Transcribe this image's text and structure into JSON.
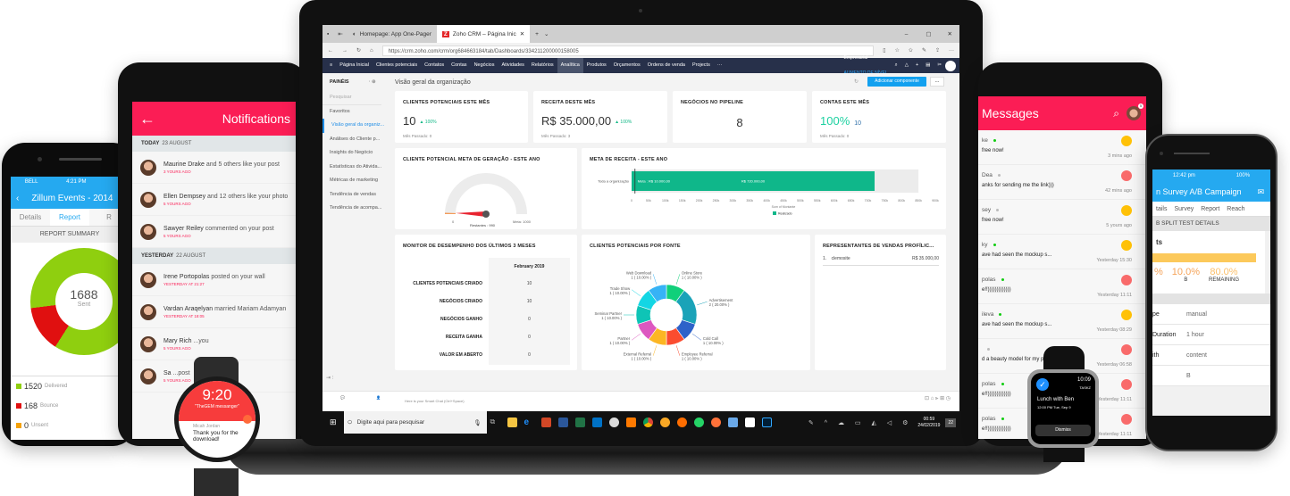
{
  "left_phone": {
    "status": {
      "carrier": "BELL",
      "time": "4:21 PM"
    },
    "title": "Zillum Events - 2014",
    "tabs": [
      "Details",
      "Report",
      "R"
    ],
    "active_tab": "Report",
    "section": "REPORT SUMMARY",
    "donut": {
      "total": "1688",
      "total_label": "Sent",
      "delivered_fraction": 0.9,
      "bounce_fraction": 0.1
    },
    "legend": [
      {
        "value": "1520",
        "label": "Delivered",
        "pct": "90",
        "color": "#8fcf0f"
      },
      {
        "value": "168",
        "label": "Bounce",
        "pct": "10",
        "color": "#e01010"
      },
      {
        "value": "0",
        "label": "Unsent",
        "pct": "",
        "color": "#f5a20a"
      }
    ]
  },
  "left_tablet": {
    "title": "Notifications",
    "groups": [
      {
        "day": "TODAY",
        "date": "23 AUGUST",
        "items": [
          {
            "name": "Maurine Drake",
            "rest": " and 5 others like your post",
            "time": "3 YOURS AGO"
          },
          {
            "name": "Ellen Dempsey",
            "rest": " and 12 others like your photo",
            "time": "5 YOURS AGO"
          },
          {
            "name": "Sawyer Reiley",
            "rest": " commented on your post",
            "time": "5 YOURS AGO"
          }
        ]
      },
      {
        "day": "YESTERDAY",
        "date": "22 AUGUST",
        "items": [
          {
            "name": "Irene Portopolas",
            "rest": " posted on your wall",
            "time": "YESTERDAY AT 21:27"
          },
          {
            "name": "Vardan Araqelyan",
            "rest": " married Mariam Adamyan",
            "time": "YESTERDAY AT 18:05"
          },
          {
            "name": "Mary Rich",
            "rest": " ...you",
            "time": "5 YOURS AGO"
          },
          {
            "name": "Sa",
            "rest": " ...post",
            "time": "5 YOURS AGO"
          }
        ]
      }
    ]
  },
  "watch_left": {
    "time": "9:20",
    "app": "\"TheGEM messanger\"",
    "sender": "Micah Jordan",
    "message": "Thank you for the download!"
  },
  "browser": {
    "tabs": [
      {
        "label": "Homepage: App One-Pager",
        "active": false
      },
      {
        "label": "Zoho CRM – Página Inic",
        "active": true
      }
    ],
    "url": "https://crm.zoho.com/crm/org684663184/tab/Dashboards/334211200000158005"
  },
  "crm": {
    "nav": [
      "Página Inicial",
      "Clientes potenciais",
      "Contatos",
      "Contas",
      "Negócios",
      "Atividades",
      "Relatórios",
      "Analítica",
      "Produtos",
      "Orçamentos",
      "Ordens de venda",
      "Projects",
      "···"
    ],
    "active_nav": "Analítica",
    "edition": "Empresarial",
    "upgrade": "AUMENTO DE NÍVEL",
    "sidebar": {
      "title": "PAINÉIS",
      "search_placeholder": "Pesquisar",
      "items": [
        "Favoritos",
        "Visão geral da organiz...",
        "Análises do Cliente p...",
        "Insights do Negócio",
        "Estatísticas do Ativida...",
        "Métricas de marketing",
        "Tendência de vendas",
        "Tendência de acompa..."
      ],
      "active": "Visão geral da organiz..."
    },
    "page_title": "Visão geral da organização",
    "add_component": "Adicionar componente",
    "more": "...",
    "kpis": [
      {
        "title": "CLIENTES POTENCIAIS ESTE MÊS",
        "value": "10",
        "change": "▲ 100%",
        "prev": "Mês Passado: 0"
      },
      {
        "title": "RECEITA DESTE MÊS",
        "value": "R$ 35.000,00",
        "change": "▲ 100%",
        "prev": "Mês Passado: 3"
      },
      {
        "title": "NEGÓCIOS NO PIPELINE",
        "value": "8",
        "change": "",
        "prev": ""
      },
      {
        "title": "CONTAS ESTE MÊS",
        "value": "100%",
        "sub": "10",
        "prev": "Mês Passado: 0"
      }
    ],
    "gauge": {
      "title": "CLIENTE POTENCIAL META DE GERAÇÃO - ESTE ANO",
      "min": "0",
      "max": "Meta: 1000",
      "remaining": "Restantes : 990",
      "value": 10,
      "target": 1000
    },
    "monitor": {
      "title": "MONITOR DE DESEMPENHO DOS ÚLTIMOS 3 MESES",
      "column": "February 2019",
      "rows": [
        {
          "label": "CLIENTES POTENCIAIS CRIADO",
          "value": "10"
        },
        {
          "label": "NEGÓCIOS CRIADO",
          "value": "10"
        },
        {
          "label": "NEGÓCIOS GANHO",
          "value": "0"
        },
        {
          "label": "RECEITA GANHA",
          "value": "0"
        },
        {
          "label": "VALOR EM ABERTO",
          "value": "0"
        }
      ]
    },
    "reps": {
      "title": "REPRESENTANTES DE VENDAS PROFÍLIC...",
      "rows": [
        {
          "rank": "1.",
          "name": "clemosite",
          "value": "R$ 35.000,00"
        }
      ]
    },
    "bottom": {
      "smart_chat": "Here is your Smart Chat (Ctrl+Space)"
    }
  },
  "chart_data": [
    {
      "type": "bar",
      "title": "META DE RECEITA - ESTE ANO",
      "categories": [
        "Toda a organização"
      ],
      "series": [
        {
          "name": "Realizado",
          "values": [
            720000
          ]
        }
      ],
      "target_label": "Meta : R$ 10.000,00",
      "value_label": "R$ 720.000,00",
      "xlabel": "Sum of Montante",
      "xticks": [
        "0",
        "50k",
        "100k",
        "150k",
        "200k",
        "250k",
        "300k",
        "350k",
        "400k",
        "450k",
        "500k",
        "550k",
        "600k",
        "650k",
        "700k",
        "750k",
        "800k",
        "850k",
        "900k"
      ],
      "xlim": [
        0,
        900000
      ],
      "background_max": 850000,
      "legend": "bottom",
      "color": "#0fb78a"
    },
    {
      "type": "pie",
      "title": "CLIENTES POTENCIAIS POR FONTE",
      "slices": [
        {
          "label": "Online Store",
          "value": 1,
          "pct": "10.00%",
          "color": "#10d07a"
        },
        {
          "label": "Advertisement",
          "value": 2,
          "pct": "20.00%",
          "color": "#1aa3b8"
        },
        {
          "label": "Cold Call",
          "value": 1,
          "pct": "10.00%",
          "color": "#2e62c9"
        },
        {
          "label": "Employee Referral",
          "value": 1,
          "pct": "10.00%",
          "color": "#fb4c2f"
        },
        {
          "label": "External Referral",
          "value": 1,
          "pct": "10.00%",
          "color": "#fcb623"
        },
        {
          "label": "Partner",
          "value": 1,
          "pct": "10.00%",
          "color": "#dd58c0"
        },
        {
          "label": "Seminar Partner",
          "value": 1,
          "pct": "10.00%",
          "color": "#0ec4b6"
        },
        {
          "label": "Trade Show",
          "value": 1,
          "pct": "10.00%",
          "color": "#13d6e4"
        },
        {
          "label": "Web Download",
          "value": 1,
          "pct": "10.00%",
          "color": "#36b3f6"
        }
      ],
      "donut": true
    }
  ],
  "taskbar": {
    "search_placeholder": "Digite aqui para pesquisar",
    "time": "00:59",
    "date": "24/02/2019",
    "notifications": "22"
  },
  "right_tablet": {
    "title": "Messages",
    "badge": "5",
    "items": [
      {
        "name": "ke",
        "online": true,
        "msg": "free now!",
        "time": "3 mins ago",
        "badge_color": "#ffc107"
      },
      {
        "name": "Dea",
        "online": false,
        "msg": "anks for sending me the link)))",
        "time": "42 mins ago",
        "badge_color": "#f96b6b"
      },
      {
        "name": "sey",
        "online": false,
        "msg": "free now!",
        "time": "5 yours ago",
        "badge_color": "#ffc107"
      },
      {
        "name": "ky",
        "online": true,
        "msg": "ave had seen the mockup s...",
        "time": "Yesterday 15:30",
        "badge_color": "#ffc107"
      },
      {
        "name": "polas",
        "online": true,
        "msg": "e!!)))))))))))))",
        "time": "Yesterday 11:11",
        "badge_color": "#f96b6b"
      },
      {
        "name": "ileva",
        "online": true,
        "msg": "ave had seen the mockup s...",
        "time": "Yesterday 08:29",
        "badge_color": "#ffc107"
      },
      {
        "name": "",
        "online": false,
        "msg": "d a beauty model for my p...",
        "time": "Yesterday 06:58",
        "badge_color": "#f96b6b"
      },
      {
        "name": "polas",
        "online": true,
        "msg": "e!!)))))))))))))",
        "time": "Yesterday 11:11",
        "badge_color": "#f96b6b"
      },
      {
        "name": "polas",
        "online": true,
        "msg": "e!!)))))))))))))",
        "time": "Yesterday 11:11",
        "badge_color": "#f96b6b"
      }
    ]
  },
  "watch_right": {
    "time": "10:09",
    "app": "TASKZ",
    "title": "Lunch with Ben",
    "when": "12:00 PM  Tue, Sep 9",
    "action": "Dismiss"
  },
  "right_phone": {
    "status": {
      "time": "12:42 pm",
      "battery": "100%"
    },
    "title": "n Survey A/B Campaign",
    "tabs": [
      "tails",
      "Survey",
      "Report",
      "Reach"
    ],
    "section": "B SPLIT TEST DETAILS",
    "card_title": "ts",
    "split": [
      {
        "value": "%",
        "label": ""
      },
      {
        "value": "10.0%",
        "label": "B"
      },
      {
        "value": "80.0%",
        "label": "REMAINING"
      }
    ],
    "details": [
      {
        "key": "pe",
        "value": "manual"
      },
      {
        "key": "Duration",
        "value": "1 hour"
      },
      {
        "key": "ith",
        "value": "content"
      },
      {
        "key": "",
        "value": "B"
      }
    ]
  }
}
